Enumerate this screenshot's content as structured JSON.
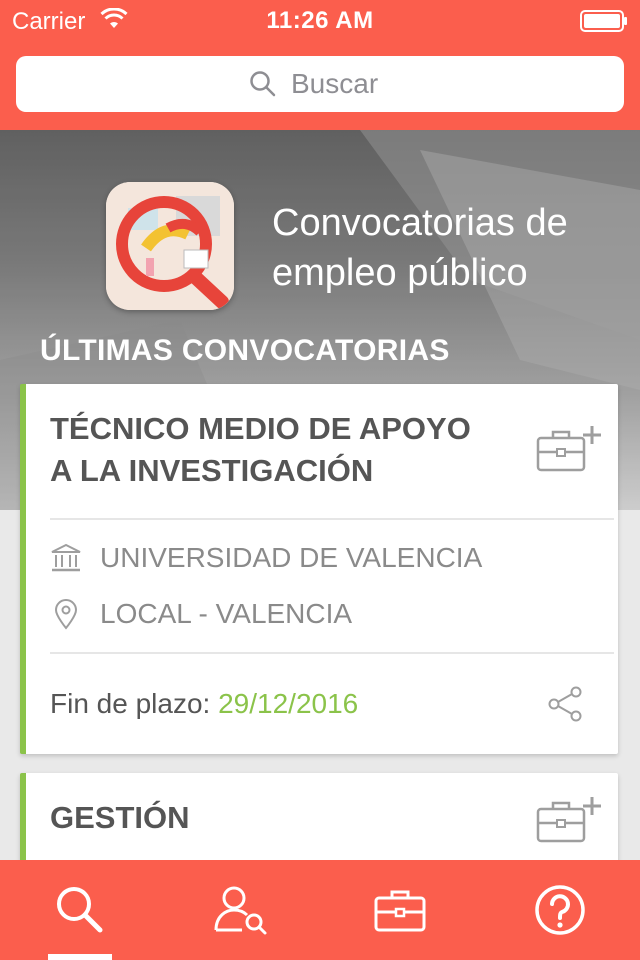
{
  "status_bar": {
    "carrier": "Carrier",
    "time": "11:26 AM"
  },
  "search": {
    "placeholder": "Buscar"
  },
  "hero": {
    "app_title": "Convocatorias de\nempleo público",
    "section_title": "ÚLTIMAS CONVOCATORIAS"
  },
  "cards": [
    {
      "title": "TÉCNICO MEDIO DE APOYO\nA LA INVESTIGACIÓN",
      "organization": "UNIVERSIDAD DE VALENCIA",
      "location": "LOCAL - VALENCIA",
      "deadline_label": "Fin de plazo:",
      "deadline_date": "29/12/2016"
    },
    {
      "title": "GESTIÓN"
    }
  ],
  "tabbar": {
    "tabs": [
      "search-icon",
      "user-search-icon",
      "briefcase-icon",
      "help-icon"
    ],
    "active_index": 0
  },
  "colors": {
    "brand": "#fb5e4d",
    "accent_green": "#8bc34a",
    "text_dark": "#555555",
    "text_muted": "#8a8a8a"
  }
}
